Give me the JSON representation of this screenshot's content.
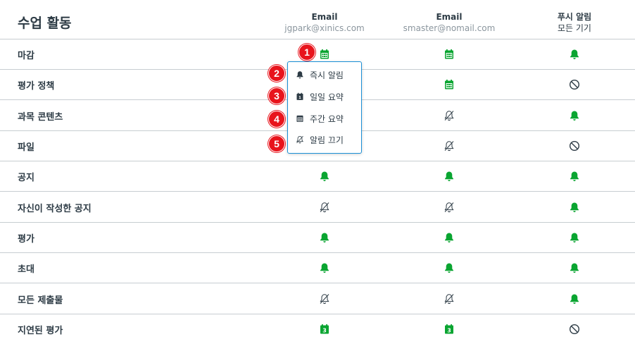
{
  "page": {
    "title": "수업 활동"
  },
  "columns": [
    {
      "line1": "Email",
      "line2": "jgpark@xinics.com"
    },
    {
      "line1": "Email",
      "line2": "smaster@nomail.com"
    },
    {
      "line1": "푸시 알림",
      "line2": "모든 기기"
    }
  ],
  "rows": [
    {
      "label": "마감",
      "cells": [
        "calendar-icon",
        "calendar-icon",
        "bell-icon"
      ]
    },
    {
      "label": "평가 정책",
      "cells": [
        "",
        "calendar-icon",
        "no-icon"
      ]
    },
    {
      "label": "과목 콘텐츠",
      "cells": [
        "",
        "bell-off-icon",
        "bell-icon"
      ]
    },
    {
      "label": "파일",
      "cells": [
        "",
        "bell-off-icon",
        "no-icon"
      ]
    },
    {
      "label": "공지",
      "cells": [
        "bell-icon",
        "bell-icon",
        "bell-icon"
      ]
    },
    {
      "label": "자신이 작성한 공지",
      "cells": [
        "bell-off-icon",
        "bell-off-icon",
        "bell-icon"
      ]
    },
    {
      "label": "평가",
      "cells": [
        "bell-icon",
        "bell-icon",
        "bell-icon"
      ]
    },
    {
      "label": "초대",
      "cells": [
        "bell-icon",
        "bell-icon",
        "bell-icon"
      ]
    },
    {
      "label": "모든 제출물",
      "cells": [
        "bell-off-icon",
        "bell-off-icon",
        "bell-icon"
      ]
    },
    {
      "label": "지연된 평가",
      "cells": [
        "calendar-weekly-icon",
        "calendar-weekly-icon",
        "no-icon"
      ]
    }
  ],
  "popup": {
    "items": [
      {
        "label": "즉시 알림",
        "icon": "bell-icon"
      },
      {
        "label": "일일 요약",
        "icon": "calendar-daily-icon"
      },
      {
        "label": "주간 요약",
        "icon": "calendar-icon"
      },
      {
        "label": "알림 끄기",
        "icon": "bell-off-icon"
      }
    ]
  },
  "badges": [
    "1",
    "2",
    "3",
    "4",
    "5"
  ],
  "colors": {
    "green": "#0aa531",
    "text": "#2d3b45",
    "popup_border": "#1a8fd6",
    "badge": "#e8141c"
  }
}
